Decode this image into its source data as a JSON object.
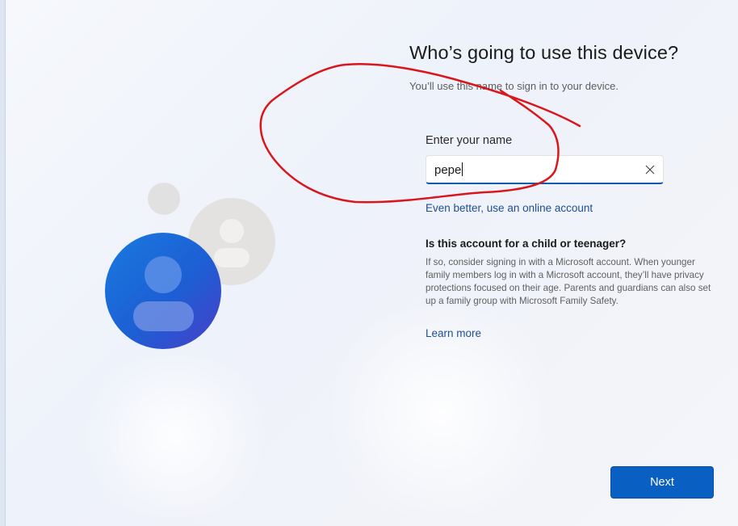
{
  "page": {
    "title": "Who’s going to use this device?",
    "subtitle": "You’ll use this name to sign in to your device."
  },
  "name_field": {
    "label": "Enter your name",
    "value": "pepe",
    "clear_icon": "close-icon"
  },
  "online_account_link": "Even better, use an online account",
  "child_section": {
    "heading": "Is this account for a child or teenager?",
    "body": "If so, consider signing in with a Microsoft account. When younger family members log in with a Microsoft account, they’ll have privacy protections focused on their age. Parents and guardians can also set up a family group with Microsoft Family Safety."
  },
  "learn_more_link": "Learn more",
  "next_button": "Next",
  "colors": {
    "accent": "#0a5fc2",
    "link": "#1d4f91",
    "annotation": "#d9161c"
  },
  "icons": {
    "illustration": "users-illustration"
  }
}
